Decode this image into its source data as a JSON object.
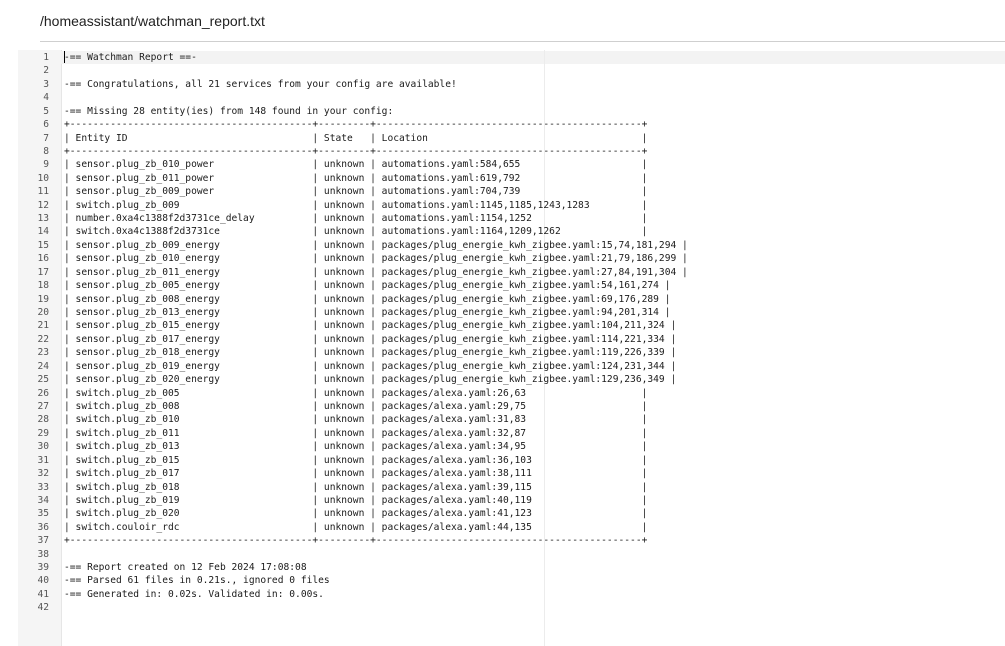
{
  "file_path": "/homeassistant/watchman_report.txt",
  "lines": [
    "-== Watchman Report ==-",
    "",
    "-== Congratulations, all 21 services from your config are available!",
    "",
    "-== Missing 28 entity(ies) from 148 found in your config:",
    "+------------------------------------------+---------+----------------------------------------------+",
    "| Entity ID                                | State   | Location                                     |",
    "+------------------------------------------+---------+----------------------------------------------+",
    "| sensor.plug_zb_010_power                 | unknown | automations.yaml:584,655                     |",
    "| sensor.plug_zb_011_power                 | unknown | automations.yaml:619,792                     |",
    "| sensor.plug_zb_009_power                 | unknown | automations.yaml:704,739                     |",
    "| switch.plug_zb_009                       | unknown | automations.yaml:1145,1185,1243,1283         |",
    "| number.0xa4c1388f2d3731ce_delay          | unknown | automations.yaml:1154,1252                   |",
    "| switch.0xa4c1388f2d3731ce                | unknown | automations.yaml:1164,1209,1262              |",
    "| sensor.plug_zb_009_energy                | unknown | packages/plug_energie_kwh_zigbee.yaml:15,74,181,294 |",
    "| sensor.plug_zb_010_energy                | unknown | packages/plug_energie_kwh_zigbee.yaml:21,79,186,299 |",
    "| sensor.plug_zb_011_energy                | unknown | packages/plug_energie_kwh_zigbee.yaml:27,84,191,304 |",
    "| sensor.plug_zb_005_energy                | unknown | packages/plug_energie_kwh_zigbee.yaml:54,161,274 |",
    "| sensor.plug_zb_008_energy                | unknown | packages/plug_energie_kwh_zigbee.yaml:69,176,289 |",
    "| sensor.plug_zb_013_energy                | unknown | packages/plug_energie_kwh_zigbee.yaml:94,201,314 |",
    "| sensor.plug_zb_015_energy                | unknown | packages/plug_energie_kwh_zigbee.yaml:104,211,324 |",
    "| sensor.plug_zb_017_energy                | unknown | packages/plug_energie_kwh_zigbee.yaml:114,221,334 |",
    "| sensor.plug_zb_018_energy                | unknown | packages/plug_energie_kwh_zigbee.yaml:119,226,339 |",
    "| sensor.plug_zb_019_energy                | unknown | packages/plug_energie_kwh_zigbee.yaml:124,231,344 |",
    "| sensor.plug_zb_020_energy                | unknown | packages/plug_energie_kwh_zigbee.yaml:129,236,349 |",
    "| switch.plug_zb_005                       | unknown | packages/alexa.yaml:26,63                    |",
    "| switch.plug_zb_008                       | unknown | packages/alexa.yaml:29,75                    |",
    "| switch.plug_zb_010                       | unknown | packages/alexa.yaml:31,83                    |",
    "| switch.plug_zb_011                       | unknown | packages/alexa.yaml:32,87                    |",
    "| switch.plug_zb_013                       | unknown | packages/alexa.yaml:34,95                    |",
    "| switch.plug_zb_015                       | unknown | packages/alexa.yaml:36,103                   |",
    "| switch.plug_zb_017                       | unknown | packages/alexa.yaml:38,111                   |",
    "| switch.plug_zb_018                       | unknown | packages/alexa.yaml:39,115                   |",
    "| switch.plug_zb_019                       | unknown | packages/alexa.yaml:40,119                   |",
    "| switch.plug_zb_020                       | unknown | packages/alexa.yaml:41,123                   |",
    "| switch.couloir_rdc                       | unknown | packages/alexa.yaml:44,135                   |",
    "+------------------------------------------+---------+----------------------------------------------+",
    "",
    "-== Report created on 12 Feb 2024 17:08:08",
    "-== Parsed 61 files in 0.21s., ignored 0 files",
    "-== Generated in: 0.02s. Validated in: 0.00s.",
    ""
  ]
}
